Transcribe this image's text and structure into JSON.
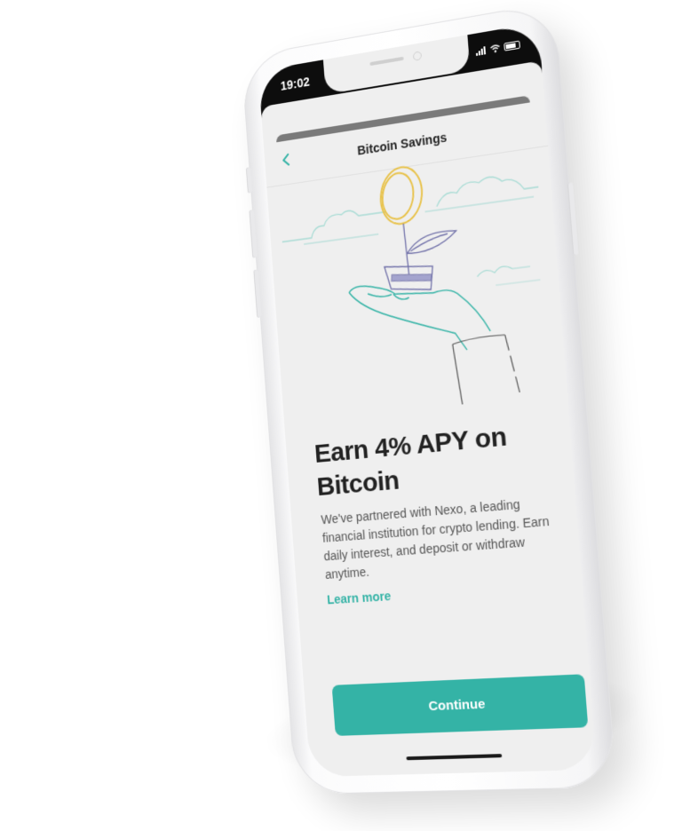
{
  "status_bar": {
    "time": "19:02"
  },
  "nav": {
    "title": "Bitcoin Savings",
    "back_icon": "chevron-left-icon"
  },
  "hero": {
    "illustration": "plant-coin-hand-illustration"
  },
  "content": {
    "headline": "Earn 4% APY on Bitcoin",
    "body": "We've partnered with Nexo, a leading financial institution for crypto lending. Earn daily interest, and deposit or withdraw anytime.",
    "learn_more": "Learn more"
  },
  "actions": {
    "continue_label": "Continue"
  },
  "colors": {
    "accent": "#34b3a6",
    "background": "#efefef",
    "coin": "#e8c24a",
    "leaf": "#6f6fa8"
  }
}
